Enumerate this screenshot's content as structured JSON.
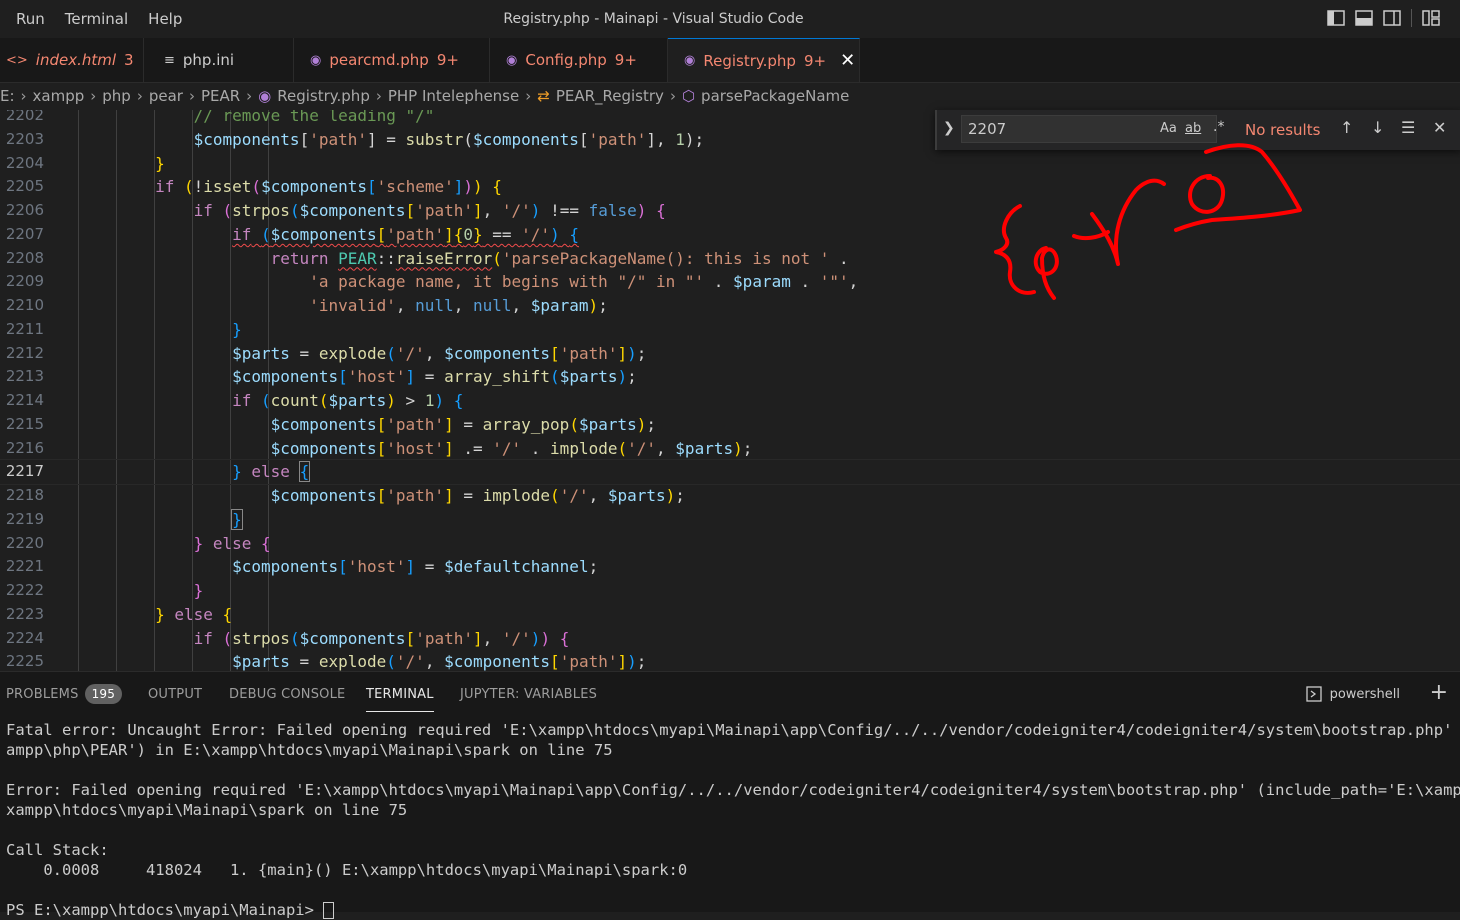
{
  "menu": [
    "Run",
    "Terminal",
    "Help"
  ],
  "window_title": "Registry.php - Mainapi - Visual Studio Code",
  "tabs": [
    {
      "label": "index.html",
      "badge": "3",
      "icon": "angle-brackets-icon",
      "color": "#f48771"
    },
    {
      "label": "php.ini",
      "badge": "",
      "icon": "lines-icon",
      "color": "#cccccc"
    },
    {
      "label": "pearcmd.php",
      "badge": "9+",
      "icon": "php-elephant-icon",
      "color": "#f48771"
    },
    {
      "label": "Config.php",
      "badge": "9+",
      "icon": "php-elephant-icon",
      "color": "#f48771"
    },
    {
      "label": "Registry.php",
      "badge": "9+",
      "icon": "php-elephant-icon",
      "color": "#f48771",
      "active": true
    }
  ],
  "breadcrumb": [
    "E:",
    "xampp",
    "php",
    "pear",
    "PEAR",
    "Registry.php",
    "PHP Intelephense",
    "PEAR_Registry",
    "parsePackageName"
  ],
  "find": {
    "query": "2207",
    "case_label": "Aa",
    "word_label": "ab",
    "regex_label": ".*",
    "result": "No results"
  },
  "editor": {
    "current_line": 2217,
    "lines": [
      {
        "n": "2202",
        "html": "            <span class=\"c\">// remove the leading \"/\"</span>"
      },
      {
        "n": "2203",
        "html": "            <span class=\"v\">$components</span>[<span class=\"s\">'path'</span>] = <span class=\"f\">substr</span>(<span class=\"v\">$components</span>[<span class=\"s\">'path'</span>], <span class=\"n\">1</span>);"
      },
      {
        "n": "2204",
        "html": "        <span class=\"b1\">}</span>"
      },
      {
        "n": "2205",
        "html": "        <span class=\"ctl\">if</span> <span class=\"b1\">(</span>!<span class=\"f\">isset</span><span class=\"b2\">(</span><span class=\"v\">$components</span><span class=\"b3\">[</span><span class=\"s\">'scheme'</span><span class=\"b3\">]</span><span class=\"b2\">)</span><span class=\"b1\">)</span> <span class=\"b1\">{</span>"
      },
      {
        "n": "2206",
        "html": "            <span class=\"ctl\">if</span> <span class=\"b2\">(</span><span class=\"f\">strpos</span><span class=\"b3\">(</span><span class=\"v\">$components</span><span class=\"b1\">[</span><span class=\"s\">'path'</span><span class=\"b1\">]</span>, <span class=\"s\">'/'</span><span class=\"b3\">)</span> !== <span class=\"k\">false</span><span class=\"b2\">)</span> <span class=\"b2\">{</span>"
      },
      {
        "n": "2207",
        "html": "                <span class=\"squig\"><span class=\"ctl\">if</span> <span class=\"b3\">(</span><span class=\"v\">$components</span><span class=\"b1\">[</span><span class=\"s\">'path'</span><span class=\"b1\">]</span><span class=\"b1\">{</span><span class=\"n\">0</span><span class=\"b1\">}</span> == <span class=\"s\">'/'</span><span class=\"b3\">)</span> <span class=\"b3\">{</span></span>"
      },
      {
        "n": "2208",
        "html": "                    <span class=\"ctl\">return</span> <span class=\"cl squig\">PEAR</span>::<span class=\"f squig\">raiseError</span><span class=\"b1\">(</span><span class=\"s\">'parsePackageName(): this is not '</span> ."
      },
      {
        "n": "2209",
        "html": "                        <span class=\"s\">'a package name, it begins with \"/\" in \"'</span> . <span class=\"v\">$param</span> . <span class=\"s\">'\"'</span>,"
      },
      {
        "n": "2210",
        "html": "                        <span class=\"s\">'invalid'</span>, <span class=\"k\">null</span>, <span class=\"k\">null</span>, <span class=\"v\">$param</span><span class=\"b1\">)</span>;"
      },
      {
        "n": "2211",
        "html": "                <span class=\"b3\">}</span>"
      },
      {
        "n": "2212",
        "html": "                <span class=\"v\">$parts</span> = <span class=\"f\">explode</span><span class=\"b3\">(</span><span class=\"s\">'/'</span>, <span class=\"v\">$components</span><span class=\"b1\">[</span><span class=\"s\">'path'</span><span class=\"b1\">]</span><span class=\"b3\">)</span>;"
      },
      {
        "n": "2213",
        "html": "                <span class=\"v\">$components</span><span class=\"b3\">[</span><span class=\"s\">'host'</span><span class=\"b3\">]</span> = <span class=\"f\">array_shift</span><span class=\"b3\">(</span><span class=\"v\">$parts</span><span class=\"b3\">)</span>;"
      },
      {
        "n": "2214",
        "html": "                <span class=\"ctl\">if</span> <span class=\"b3\">(</span><span class=\"f\">count</span><span class=\"b1\">(</span><span class=\"v\">$parts</span><span class=\"b1\">)</span> &gt; <span class=\"n\">1</span><span class=\"b3\">)</span> <span class=\"b3\">{</span>"
      },
      {
        "n": "2215",
        "html": "                    <span class=\"v\">$components</span><span class=\"b1\">[</span><span class=\"s\">'path'</span><span class=\"b1\">]</span> = <span class=\"f\">array_pop</span><span class=\"b1\">(</span><span class=\"v\">$parts</span><span class=\"b1\">)</span>;"
      },
      {
        "n": "2216",
        "html": "                    <span class=\"v\">$components</span><span class=\"b1\">[</span><span class=\"s\">'host'</span><span class=\"b1\">]</span> .= <span class=\"s\">'/'</span> . <span class=\"f\">implode</span><span class=\"b1\">(</span><span class=\"s\">'/'</span>, <span class=\"v\">$parts</span><span class=\"b1\">)</span>;"
      },
      {
        "n": "2217",
        "html": "                <span class=\"b3\">}</span> <span class=\"ctl\">else</span> <span class=\"b3\" style=\"outline:1px solid #888\">{</span>"
      },
      {
        "n": "2218",
        "html": "                    <span class=\"v\">$components</span><span class=\"b1\">[</span><span class=\"s\">'path'</span><span class=\"b1\">]</span> = <span class=\"f\">implode</span><span class=\"b1\">(</span><span class=\"s\">'/'</span>, <span class=\"v\">$parts</span><span class=\"b1\">)</span>;"
      },
      {
        "n": "2219",
        "html": "                <span class=\"b3\" style=\"outline:1px solid #888\">}</span>"
      },
      {
        "n": "2220",
        "html": "            <span class=\"b2\">}</span> <span class=\"ctl\">else</span> <span class=\"b2\">{</span>"
      },
      {
        "n": "2221",
        "html": "                <span class=\"v\">$components</span><span class=\"b3\">[</span><span class=\"s\">'host'</span><span class=\"b3\">]</span> = <span class=\"v\">$defaultchannel</span>;"
      },
      {
        "n": "2222",
        "html": "            <span class=\"b2\">}</span>"
      },
      {
        "n": "2223",
        "html": "        <span class=\"b1\">}</span> <span class=\"ctl\">else</span> <span class=\"b1\">{</span>"
      },
      {
        "n": "2224",
        "html": "            <span class=\"ctl\">if</span> <span class=\"b2\">(</span><span class=\"f\">strpos</span><span class=\"b3\">(</span><span class=\"v\">$components</span><span class=\"b1\">[</span><span class=\"s\">'path'</span><span class=\"b1\">]</span>, <span class=\"s\">'/'</span><span class=\"b3\">)</span><span class=\"b2\">)</span> <span class=\"b2\">{</span>"
      },
      {
        "n": "2225",
        "html": "                <span class=\"v\">$parts</span> = <span class=\"f\">explode</span><span class=\"b3\">(</span><span class=\"s\">'/'</span>, <span class=\"v\">$components</span><span class=\"b1\">[</span><span class=\"s\">'path'</span><span class=\"b1\">]</span><span class=\"b3\">)</span>;"
      }
    ]
  },
  "panel": {
    "tabs": [
      "PROBLEMS",
      "OUTPUT",
      "DEBUG CONSOLE",
      "TERMINAL",
      "JUPYTER: VARIABLES"
    ],
    "problems_count": "195",
    "active_tab": "TERMINAL",
    "shell_label": "powershell"
  },
  "terminal": {
    "lines": [
      "Fatal error: Uncaught Error: Failed opening required 'E:\\xampp\\htdocs\\myapi\\Mainapi\\app\\Config/../../vendor/codeigniter4/codeigniter4/system\\bootstrap.php' (inclu",
      "ampp\\php\\PEAR') in E:\\xampp\\htdocs\\myapi\\Mainapi\\spark on line 75",
      "",
      "Error: Failed opening required 'E:\\xampp\\htdocs\\myapi\\Mainapi\\app\\Config/../../vendor/codeigniter4/codeigniter4/system\\bootstrap.php' (include_path='E:\\xampp\\php\\",
      "xampp\\htdocs\\myapi\\Mainapi\\spark on line 75",
      "",
      "Call Stack:",
      "    0.0008     418024   1. {main}() E:\\xampp\\htdocs\\myapi\\Mainapi\\spark:0",
      "",
      "PS E:\\xampp\\htdocs\\myapi\\Mainapi> "
    ]
  },
  "colors": {
    "accent": "#0078d4",
    "error": "#f48771",
    "scribble": "#ff0000"
  }
}
